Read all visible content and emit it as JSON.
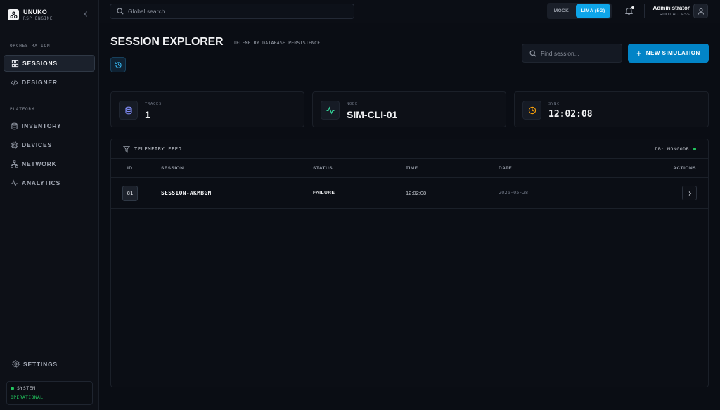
{
  "brand": {
    "name": "UNUKO",
    "subtitle": "RSP ENGINE"
  },
  "sidebar": {
    "sections": [
      {
        "label": "ORCHESTRATION"
      },
      {
        "label": "PLATFORM"
      }
    ],
    "items": [
      {
        "label": "SESSIONS",
        "icon": "grid-icon",
        "active": true
      },
      {
        "label": "DESIGNER",
        "icon": "code-icon"
      },
      {
        "label": "INVENTORY",
        "icon": "database-icon"
      },
      {
        "label": "DEVICES",
        "icon": "chip-icon"
      },
      {
        "label": "NETWORK",
        "icon": "network-icon"
      },
      {
        "label": "ANALYTICS",
        "icon": "activity-icon"
      }
    ],
    "settings_label": "SETTINGS",
    "system": {
      "label": "SYSTEM",
      "status": "OPERATIONAL"
    }
  },
  "topbar": {
    "search_placeholder": "Global search...",
    "env": {
      "options": [
        "MOCK",
        "LIMA (5G)"
      ],
      "selected": "LIMA (5G)"
    },
    "user": {
      "name": "Administrator",
      "role": "ROOT ACCESS"
    }
  },
  "header": {
    "title": "SESSION EXPLORER",
    "subtitle": "TELEMETRY DATABASE PERSISTENCE",
    "find_placeholder": "Find session...",
    "new_button": "NEW SIMULATION"
  },
  "stats": [
    {
      "label": "TRACES",
      "value": "1",
      "icon": "database-icon",
      "color": "#818cf8"
    },
    {
      "label": "NODE",
      "value": "SIM-CLI-01",
      "icon": "activity-icon",
      "color": "#34d399"
    },
    {
      "label": "SYNC",
      "value": "12:02:08",
      "icon": "clock-icon",
      "color": "#f59e0b"
    }
  ],
  "table": {
    "title": "TELEMETRY FEED",
    "db_label": "DB: MONGODB",
    "columns": [
      "ID",
      "SESSION",
      "STATUS",
      "TIME",
      "DATE",
      "ACTIONS"
    ],
    "rows": [
      {
        "id": "81",
        "session": "SESSION-AKMBGN",
        "status": "FAILURE",
        "time": "12:02:08",
        "date": "2026-05-28"
      }
    ]
  },
  "colors": {
    "accent": "#0ea5e9",
    "button": "#0284c7",
    "status_ok": "#22c55e"
  }
}
